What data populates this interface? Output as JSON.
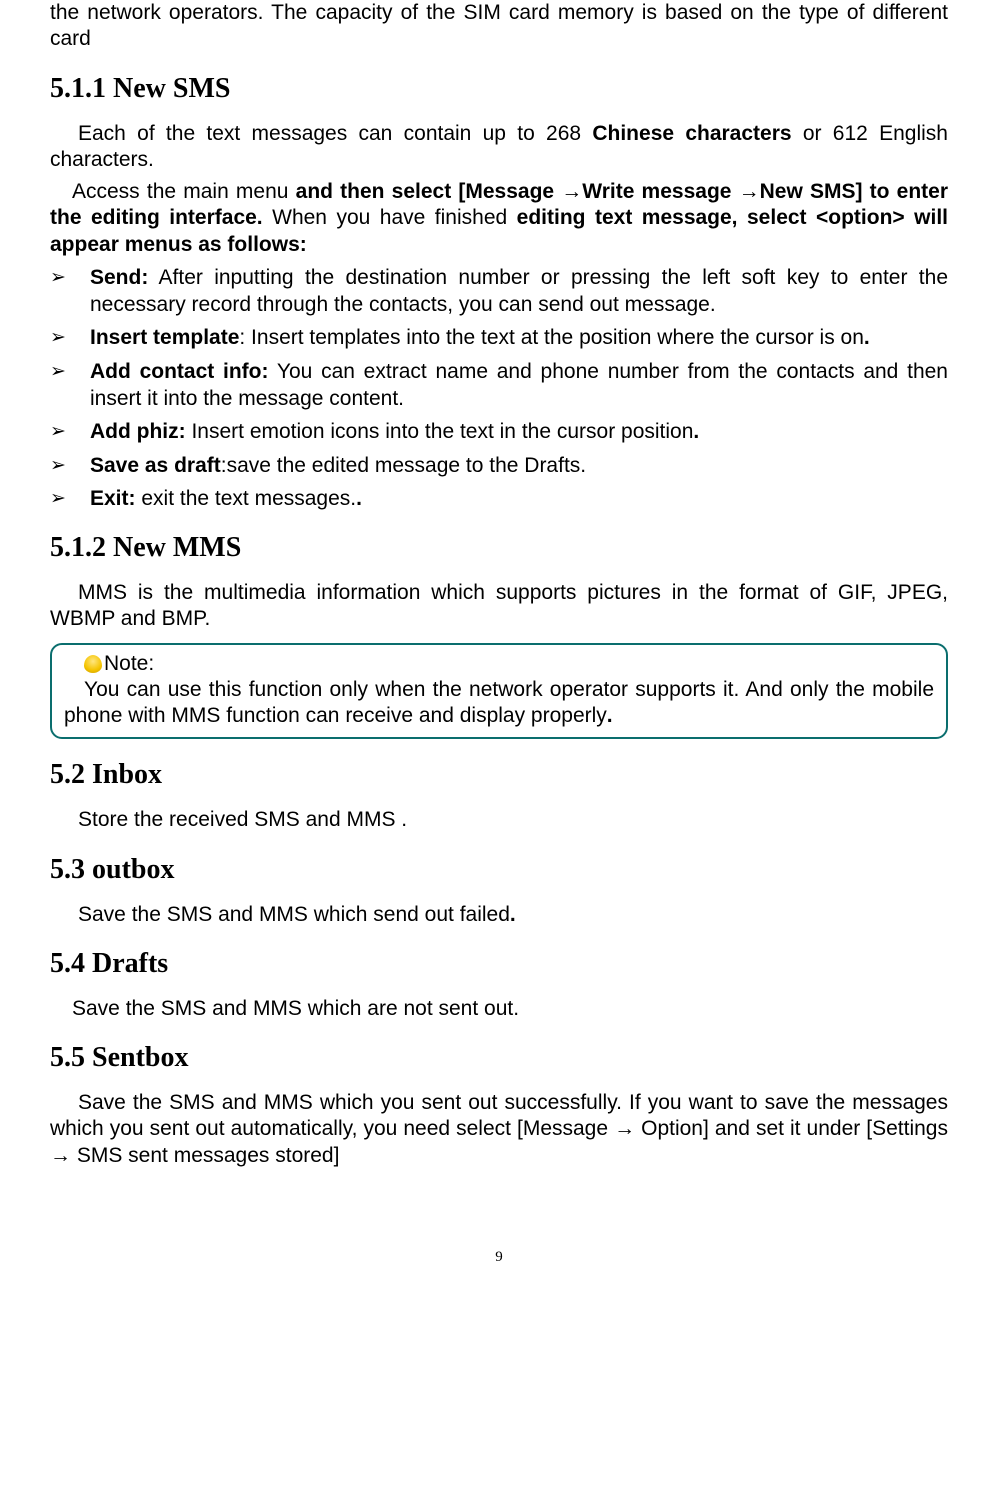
{
  "intro": {
    "line1": "the network operators. The capacity of the SIM card memory is based on the type of different card"
  },
  "s511": {
    "heading": "5.1.1 New SMS",
    "p1a": "Each of the text messages can contain up to 268 ",
    "p1b": "Chinese characters",
    "p1c": " or 612 English characters.",
    "p2a": "Access the main menu ",
    "p2b": "and then select [Message →Write message →New SMS] to enter the editing interface.",
    "p2c": " When you have finished ",
    "p2d": "editing text message, select <option> will appear menus as follows:",
    "bullets": [
      {
        "bold": "Send:",
        "rest": " After inputting the destination number or pressing the left soft key to enter the necessary record through the contacts, you can send out message."
      },
      {
        "bold": "Insert template",
        "rest": ": Insert templates into the text at the position where the cursor is on",
        "tail_bold": "."
      },
      {
        "bold": "Add contact info:",
        "rest": " You can extract name and phone number from the contacts and then insert it into the message content.",
        "tail_bold": ""
      },
      {
        "bold": "Add phiz:",
        "rest": " Insert emotion icons into the text in the cursor position",
        "tail_bold": "."
      },
      {
        "bold": "Save as draft",
        "rest": ":save the edited message to the Drafts.",
        "tail_bold": ""
      },
      {
        "bold": "Exit:",
        "rest": " exit the text messages.",
        "tail_bold": "."
      }
    ]
  },
  "s512": {
    "heading": "5.1.2 New MMS",
    "p1": "MMS is the multimedia information which supports pictures in the format of GIF, JPEG, WBMP and BMP.",
    "note_label": "Note:",
    "note_body_a": "You can use this function only when the network operator supports it. And only the mobile phone with MMS function can receive and display properly",
    "note_body_b": "."
  },
  "s52": {
    "heading": "5.2 Inbox",
    "p1": "Store the received SMS and MMS ."
  },
  "s53": {
    "heading": "5.3 outbox",
    "p1a": "Save the SMS and MMS which send out failed",
    "p1b": "."
  },
  "s54": {
    "heading": "5.4 Drafts",
    "p1": "Save the SMS and MMS which are not sent out."
  },
  "s55": {
    "heading": "5.5 Sentbox",
    "p1": "Save the SMS and MMS which you sent out successfully. If you want to save the messages which you sent out automatically, you need select [Message → Option] and set it under [Settings → SMS sent messages stored]"
  },
  "page_number": "9"
}
